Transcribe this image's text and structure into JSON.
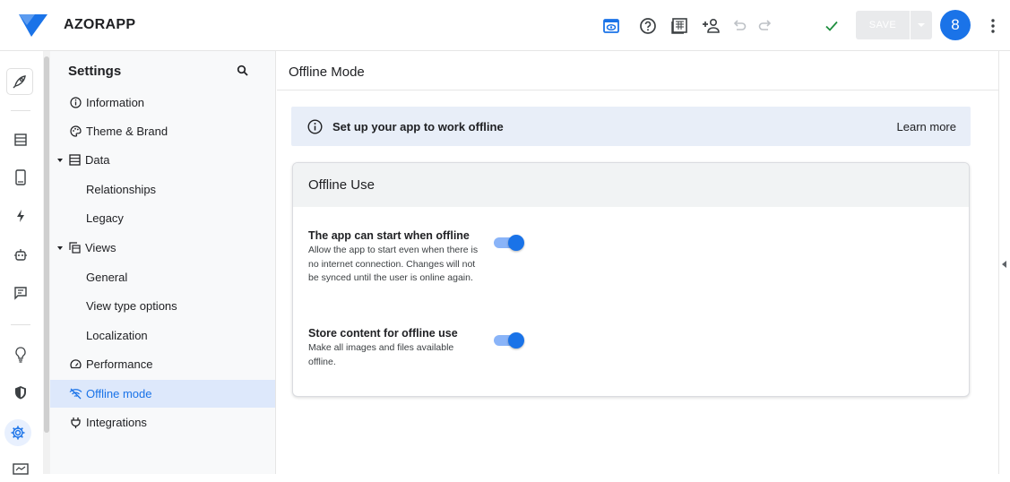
{
  "app": {
    "name": "AZORAPP"
  },
  "toolbar": {
    "icons": [
      "preview-icon",
      "help-icon",
      "table-icon",
      "add-user-icon",
      "undo-icon",
      "redo-icon",
      "check-icon",
      "more-vert-icon"
    ],
    "save_label": "SAVE",
    "avatar_text": "8",
    "colors": {
      "accent": "#1a73e8",
      "check": "#1e8e3e",
      "save_bg": "#e9eaec"
    }
  },
  "rail": {
    "icons": [
      "rocket-icon",
      "data-icon",
      "phone-icon",
      "bolt-icon",
      "robot-icon",
      "chat-icon",
      "bulb-icon",
      "shield-icon",
      "gear-icon",
      "monitor-icon"
    ]
  },
  "nav": {
    "title": "Settings",
    "items": [
      {
        "label": "Information",
        "icon": "info-icon",
        "level": 0
      },
      {
        "label": "Theme & Brand",
        "icon": "palette-icon",
        "level": 0
      },
      {
        "label": "Data",
        "icon": "table-icon",
        "level": 0,
        "expanded": true
      },
      {
        "label": "Relationships",
        "level": 1
      },
      {
        "label": "Legacy",
        "level": 1
      },
      {
        "label": "Views",
        "icon": "views-icon",
        "level": 0,
        "expanded": true
      },
      {
        "label": "General",
        "level": 1
      },
      {
        "label": "View type options",
        "level": 1
      },
      {
        "label": "Localization",
        "level": 1
      },
      {
        "label": "Performance",
        "icon": "speed-icon",
        "level": 0
      },
      {
        "label": "Offline mode",
        "icon": "wifi-off-icon",
        "level": 0,
        "active": true
      },
      {
        "label": "Integrations",
        "icon": "plug-icon",
        "level": 0
      }
    ]
  },
  "main": {
    "title": "Offline Mode",
    "banner": {
      "text": "Set up your app to work offline",
      "link": "Learn more"
    },
    "card": {
      "title": "Offline Use",
      "settings": [
        {
          "label": "The app can start when offline",
          "description": "Allow the app to start even when there is no internet connection. Changes will not be synced until the user is online again.",
          "enabled": true
        },
        {
          "label": "Store content for offline use",
          "description": "Make all images and files available offline.",
          "enabled": true
        }
      ]
    }
  }
}
